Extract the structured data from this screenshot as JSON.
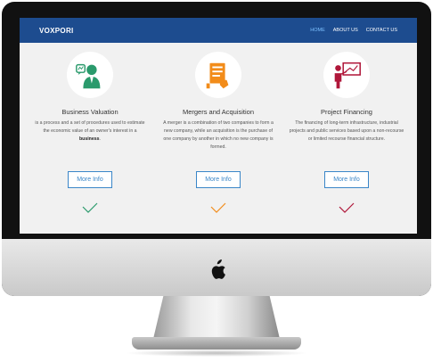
{
  "brand": "VOXPORI",
  "nav": {
    "items": [
      {
        "label": "HOME",
        "active": true
      },
      {
        "label": "ABOUT US",
        "active": false
      },
      {
        "label": "CONTACT US",
        "active": false
      }
    ]
  },
  "services": [
    {
      "title": "Business Valuation",
      "desc_before": "is a process and a set of procedures used to estimate the economic value of an owner's interest in a ",
      "desc_bold": "business",
      "desc_after": ".",
      "button": "More Info",
      "icon": "businessman-icon",
      "accent": "#2a9a6c"
    },
    {
      "title": "Mergers and Acquisition",
      "desc_before": "A merger is a combination of two companies to form a new company, while an acquisition is the purchase of one company by another in which no new company is formed.",
      "desc_bold": "",
      "desc_after": "",
      "button": "More Info",
      "icon": "document-hand-icon",
      "accent": "#f28c1a"
    },
    {
      "title": "Project Financing",
      "desc_before": "The financing of long-term infrastructure, industrial projects and public services based upon a non-recourse or limited recourse financial structure.",
      "desc_bold": "",
      "desc_after": "",
      "button": "More Info",
      "icon": "presentation-icon",
      "accent": "#b0173a"
    }
  ],
  "colors": {
    "navbar": "#1d4c8f",
    "button_border": "#3a86c8"
  }
}
